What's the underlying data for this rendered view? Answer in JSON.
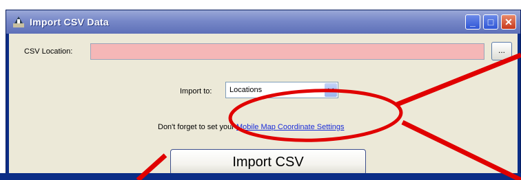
{
  "window": {
    "title": "Import CSV Data",
    "minimize_glyph": "_",
    "maximize_glyph": "□",
    "close_glyph": "✕"
  },
  "form": {
    "csv_location_label": "CSV Location:",
    "csv_location_value": "",
    "browse_label": "...",
    "import_to_label": "Import to:",
    "import_to_selected": "Locations",
    "reminder_prefix": "Don't forget to set your ",
    "reminder_link": "Mobile Map Coordinate Settings",
    "import_button_label": "Import CSV"
  },
  "icons": {
    "app": "import-app-icon",
    "dropdown": "chevron-down-icon"
  },
  "colors": {
    "title_bar": "#7788c8",
    "client_bg": "#ece9d8",
    "csv_field_invalid": "#f5b7b7",
    "link": "#1a2cd8",
    "annotation": "#e00000"
  }
}
